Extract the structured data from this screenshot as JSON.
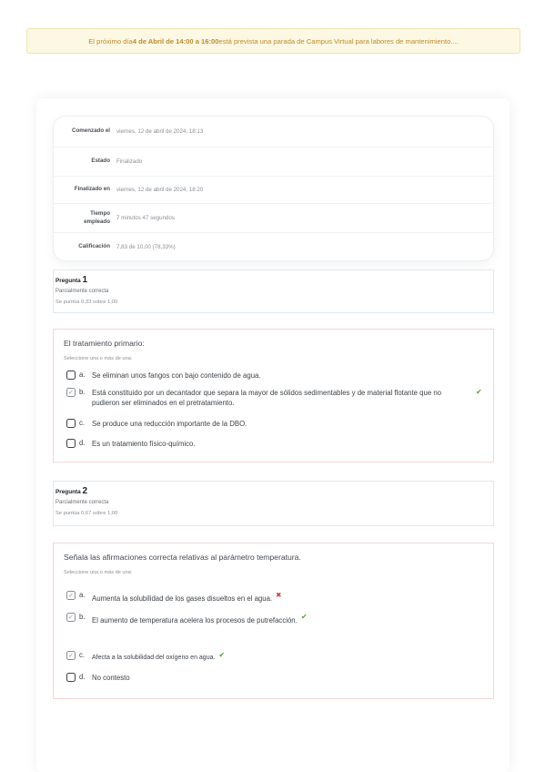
{
  "notice": {
    "prefix": "El próximo día ",
    "date_time": "4 de Abril de 14:00 a 16:00",
    "suffix": " está prevista una parada de Campus Virtual para labores de mantenimiento...."
  },
  "summary": [
    {
      "label": "Comenzado el",
      "value": "viernes, 12 de abril de 2024, 18:13"
    },
    {
      "label": "Estado",
      "value": "Finalizado"
    },
    {
      "label": "Finalizado en",
      "value": "viernes, 12 de abril de 2024, 18:20"
    },
    {
      "label": "Tiempo empleado",
      "value": "7 minutos 47 segundos"
    },
    {
      "label": "Calificación",
      "value": "7,83 de 10,00 (78,33%)"
    }
  ],
  "questions": [
    {
      "title_prefix": "Pregunta ",
      "number": "1",
      "state": "Parcialmente correcta",
      "grade": "Se puntúa 0,33 sobre 1,00",
      "text": "El tratamiento primario:",
      "prompt": "Seleccione una o más de una:",
      "options": [
        {
          "letter": "a.",
          "text": "Se eliminan unos fangos con bajo contenido de agua.",
          "checked": false,
          "mark": ""
        },
        {
          "letter": "b.",
          "text": "Está constituido por un decantador que separa la mayor de sólidos sedimentables y de material flotante que no pudieron ser eliminados en el pretratamiento.",
          "checked": true,
          "mark": "✔"
        },
        {
          "letter": "c.",
          "text": "Se produce una reducción importante de la DBO.",
          "checked": false,
          "mark": ""
        },
        {
          "letter": "d.",
          "text": "Es un tratamiento físico-químico.",
          "checked": false,
          "mark": ""
        }
      ]
    },
    {
      "title_prefix": "Pregunta ",
      "number": "2",
      "state": "Parcialmente correcta",
      "grade": "Se puntúa 0,67 sobre 1,00",
      "text": "Señala las afirmaciones correcta relativas al parámetro temperatura.",
      "prompt": "Seleccione una o más de una:",
      "options": [
        {
          "letter": "a.",
          "text": "Aumenta la solubilidad de los gases disueltos en el agua.",
          "checked": true,
          "mark": "✖"
        },
        {
          "letter": "b.",
          "text": "El aumento de temperatura acelera los procesos de putrefacción.",
          "checked": true,
          "mark": "✔"
        },
        {
          "letter": "c.",
          "text": "Afecta a la solubilidad del oxígeno en agua.",
          "checked": true,
          "mark": "✔"
        },
        {
          "letter": "d.",
          "text": "No contesto",
          "checked": false,
          "mark": ""
        }
      ]
    }
  ],
  "colors": {
    "notice_text": "#c08a2e",
    "correct": "#5a9e3a",
    "incorrect": "#d13b3b"
  }
}
